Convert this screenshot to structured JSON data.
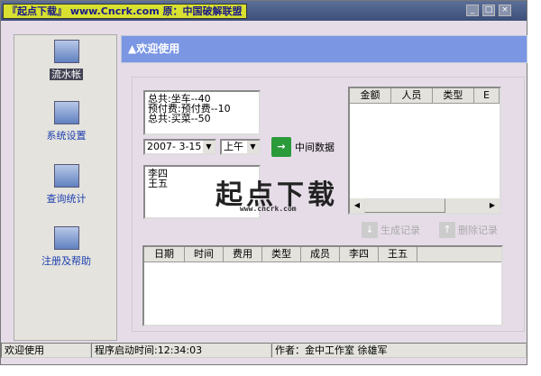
{
  "title": {
    "banner": "『起点下载』 www.Cncrk.com 原：中国破解联盟"
  },
  "sidebar": {
    "items": [
      {
        "label": "流水帐"
      },
      {
        "label": "系统设置"
      },
      {
        "label": "查询统计"
      },
      {
        "label": "注册及帮助"
      }
    ]
  },
  "header": {
    "title": "▲欢迎使用"
  },
  "summary_memo": "总共:坐车--40\n预付费:预付费--10\n总共:买菜--50",
  "date_combo": "2007- 3-15",
  "period_combo": "上午",
  "middle_data_button": "中间数据",
  "members_memo": "李四\n王五",
  "top_grid": {
    "columns": [
      "金额",
      "人员",
      "类型",
      "E"
    ]
  },
  "buttons": {
    "generate": "生成记录",
    "delete": "删除记录"
  },
  "bottom_grid": {
    "columns": [
      "日期",
      "时间",
      "费用",
      "类型",
      "成员",
      "李四",
      "王五"
    ]
  },
  "status": {
    "welcome": "欢迎使用",
    "start_time": "程序启动时间:12:34:03",
    "author": "作者：金中工作室 徐雄军"
  },
  "watermark": {
    "logo": "起点下载",
    "url": "www.cncrk.com"
  }
}
